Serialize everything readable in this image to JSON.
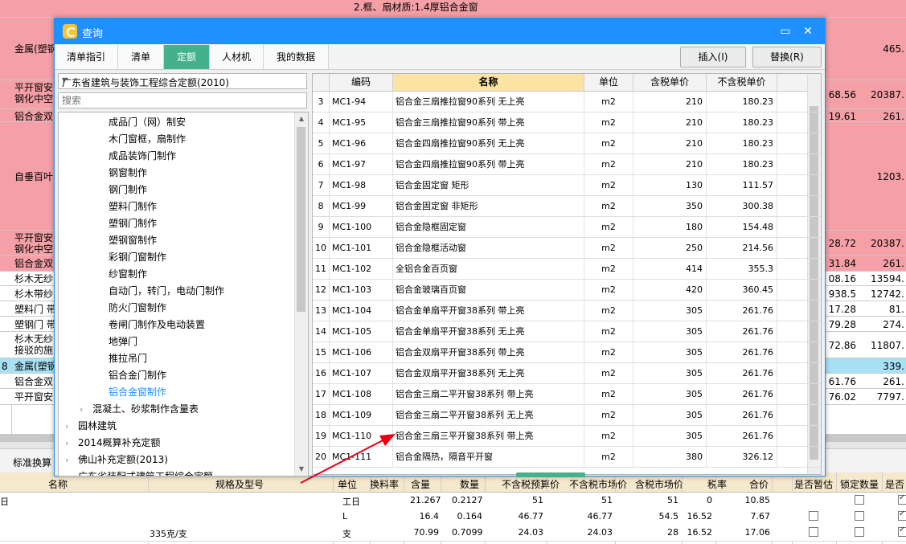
{
  "background": {
    "rows": [
      {
        "texts": [
          "2.框、扇材质:1.4厚铝合金窗"
        ],
        "value": "",
        "price": ""
      },
      {
        "texts": [
          "金属(塑钢"
        ],
        "value": "",
        "price": "465."
      },
      {
        "texts": [
          "平开窗安",
          "钢化中空"
        ],
        "value": "68.56",
        "price": "20387."
      },
      {
        "texts": [
          "铝合金双"
        ],
        "value": "19.61",
        "price": "261."
      },
      {
        "texts": [
          "自垂百叶"
        ],
        "value": "",
        "price": "1203."
      },
      {
        "texts": [
          "平开窗安",
          "钢化中空"
        ],
        "value": "28.72",
        "price": "20387."
      },
      {
        "texts": [
          "铝合金双"
        ],
        "value": "31.84",
        "price": "261."
      },
      {
        "texts": [
          "杉木无纱"
        ],
        "value": "08.16",
        "price": "13594."
      },
      {
        "texts": [
          "杉木带纱"
        ],
        "value": "938.5",
        "price": "12742."
      },
      {
        "texts": [
          "塑料门 带"
        ],
        "value": "17.28",
        "price": "81."
      },
      {
        "texts": [
          "塑钢门 带"
        ],
        "value": "79.28",
        "price": "274."
      },
      {
        "texts": [
          "杉木无纱",
          "接驳的施"
        ],
        "value": "72.86",
        "price": "11807."
      },
      {
        "texts": [
          "金属(塑钢"
        ],
        "value": "",
        "price": "339."
      },
      {
        "texts": [
          "铝合金双"
        ],
        "value": "61.76",
        "price": "261."
      },
      {
        "texts": [
          "平开窗安"
        ],
        "value": "76.02",
        "price": "7797."
      }
    ],
    "row_markers": [
      "",
      "",
      "",
      "",
      "",
      "",
      "",
      "",
      "",
      "",
      "",
      "",
      "8",
      "",
      ""
    ],
    "bottom_tab": "标准换算",
    "bottom_headers": [
      "名称",
      "规格及型号",
      "单位",
      "换料率",
      "含量",
      "数量",
      "不含税预算价",
      "不含税市场价",
      "含税市场价",
      "税率",
      "合价",
      "是否暂估",
      "锁定数量",
      "是否"
    ],
    "bottom_rows": [
      {
        "name": "日",
        "spec": "",
        "unit": "工日",
        "qty_rate": "",
        "content": "21.267",
        "amount": "0.2127",
        "p1": "51",
        "p2": "51",
        "p3": "51",
        "tax": "0",
        "total": "10.85"
      },
      {
        "name": "",
        "spec": "",
        "unit": "L",
        "qty_rate": "",
        "content": "16.4",
        "amount": "0.164",
        "p1": "46.77",
        "p2": "46.77",
        "p3": "54.5",
        "tax": "16.52",
        "total": "7.67"
      },
      {
        "name": "",
        "spec": "335克/支",
        "unit": "支",
        "qty_rate": "",
        "content": "70.99",
        "amount": "0.7099",
        "p1": "24.03",
        "p2": "24.03",
        "p3": "28",
        "tax": "16.52",
        "total": "17.06"
      }
    ]
  },
  "dialog": {
    "title": "查询",
    "tabs": [
      {
        "label": "清单指引",
        "active": false
      },
      {
        "label": "清单",
        "active": false
      },
      {
        "label": "定额",
        "active": true
      },
      {
        "label": "人材机",
        "active": false
      },
      {
        "label": "我的数据",
        "active": false
      }
    ],
    "insert_label": "插入(I)",
    "replace_label": "替换(R)",
    "library": "广东省建筑与装饰工程综合定额(2010)",
    "search_placeholder": "搜索",
    "tree": [
      {
        "label": "成品门（网）制安",
        "level": 2,
        "selected": false
      },
      {
        "label": "木门窗框，扇制作",
        "level": 2,
        "selected": false
      },
      {
        "label": "成品装饰门制作",
        "level": 2,
        "selected": false
      },
      {
        "label": "钢窗制作",
        "level": 2,
        "selected": false
      },
      {
        "label": "钢门制作",
        "level": 2,
        "selected": false
      },
      {
        "label": "塑料门制作",
        "level": 2,
        "selected": false
      },
      {
        "label": "塑钢门制作",
        "level": 2,
        "selected": false
      },
      {
        "label": "塑钢窗制作",
        "level": 2,
        "selected": false
      },
      {
        "label": "彩钢门窗制作",
        "level": 2,
        "selected": false
      },
      {
        "label": "纱窗制作",
        "level": 2,
        "selected": false
      },
      {
        "label": "自动门，转门，电动门制作",
        "level": 2,
        "selected": false
      },
      {
        "label": "防火门窗制作",
        "level": 2,
        "selected": false
      },
      {
        "label": "卷闸门制作及电动装置",
        "level": 2,
        "selected": false
      },
      {
        "label": "地弹门",
        "level": 2,
        "selected": false
      },
      {
        "label": "推拉吊门",
        "level": 2,
        "selected": false
      },
      {
        "label": "铝合金门制作",
        "level": 2,
        "selected": false
      },
      {
        "label": "铝合金窗制作",
        "level": 2,
        "selected": true
      },
      {
        "label": "混凝土、砂浆制作含量表",
        "level": 1,
        "selected": false
      },
      {
        "label": "园林建筑",
        "level": 0,
        "selected": false
      },
      {
        "label": "2014概算补充定额",
        "level": 0,
        "selected": false
      },
      {
        "label": "佛山补充定额(2013)",
        "level": 0,
        "selected": false
      },
      {
        "label": "广东省装配式建筑工程综合定额",
        "level": 0,
        "selected": false
      }
    ],
    "columns": [
      "编码",
      "名称",
      "单位",
      "含税单价",
      "不含税单价"
    ],
    "rows": [
      {
        "idx": "3",
        "code": "MC1-94",
        "name": "铝合金三扇推拉窗90系列 无上亮",
        "unit": "m2",
        "tax_price": "210",
        "notax_price": "180.23"
      },
      {
        "idx": "4",
        "code": "MC1-95",
        "name": "铝合金三扇推拉窗90系列 带上亮",
        "unit": "m2",
        "tax_price": "210",
        "notax_price": "180.23"
      },
      {
        "idx": "5",
        "code": "MC1-96",
        "name": "铝合金四扇推拉窗90系列 无上亮",
        "unit": "m2",
        "tax_price": "210",
        "notax_price": "180.23"
      },
      {
        "idx": "6",
        "code": "MC1-97",
        "name": "铝合金四扇推拉窗90系列 带上亮",
        "unit": "m2",
        "tax_price": "210",
        "notax_price": "180.23"
      },
      {
        "idx": "7",
        "code": "MC1-98",
        "name": "铝合金固定窗 矩形",
        "unit": "m2",
        "tax_price": "130",
        "notax_price": "111.57"
      },
      {
        "idx": "8",
        "code": "MC1-99",
        "name": "铝合金固定窗 非矩形",
        "unit": "m2",
        "tax_price": "350",
        "notax_price": "300.38"
      },
      {
        "idx": "9",
        "code": "MC1-100",
        "name": "铝合金隐框固定窗",
        "unit": "m2",
        "tax_price": "180",
        "notax_price": "154.48"
      },
      {
        "idx": "10",
        "code": "MC1-101",
        "name": "铝合金隐框活动窗",
        "unit": "m2",
        "tax_price": "250",
        "notax_price": "214.56"
      },
      {
        "idx": "11",
        "code": "MC1-102",
        "name": "全铝合金百页窗",
        "unit": "m2",
        "tax_price": "414",
        "notax_price": "355.3"
      },
      {
        "idx": "12",
        "code": "MC1-103",
        "name": "铝合金玻璃百页窗",
        "unit": "m2",
        "tax_price": "420",
        "notax_price": "360.45"
      },
      {
        "idx": "13",
        "code": "MC1-104",
        "name": "铝合金单扇平开窗38系列 带上亮",
        "unit": "m2",
        "tax_price": "305",
        "notax_price": "261.76"
      },
      {
        "idx": "14",
        "code": "MC1-105",
        "name": "铝合金单扇平开窗38系列 无上亮",
        "unit": "m2",
        "tax_price": "305",
        "notax_price": "261.76"
      },
      {
        "idx": "15",
        "code": "MC1-106",
        "name": "铝合金双扇平开窗38系列 带上亮",
        "unit": "m2",
        "tax_price": "305",
        "notax_price": "261.76"
      },
      {
        "idx": "16",
        "code": "MC1-107",
        "name": "铝合金双扇平开窗38系列 无上亮",
        "unit": "m2",
        "tax_price": "305",
        "notax_price": "261.76"
      },
      {
        "idx": "17",
        "code": "MC1-108",
        "name": "铝合金三扇二平开窗38系列 带上亮",
        "unit": "m2",
        "tax_price": "305",
        "notax_price": "261.76"
      },
      {
        "idx": "18",
        "code": "MC1-109",
        "name": "铝合金三扇二平开窗38系列 无上亮",
        "unit": "m2",
        "tax_price": "305",
        "notax_price": "261.76"
      },
      {
        "idx": "19",
        "code": "MC1-110",
        "name": "铝合金三扇三平开窗38系列 带上亮",
        "unit": "m2",
        "tax_price": "305",
        "notax_price": "261.76"
      },
      {
        "idx": "20",
        "code": "MC1-111",
        "name": "铝合金隔热，隔音平开窗",
        "unit": "m2",
        "tax_price": "380",
        "notax_price": "326.12"
      }
    ]
  }
}
